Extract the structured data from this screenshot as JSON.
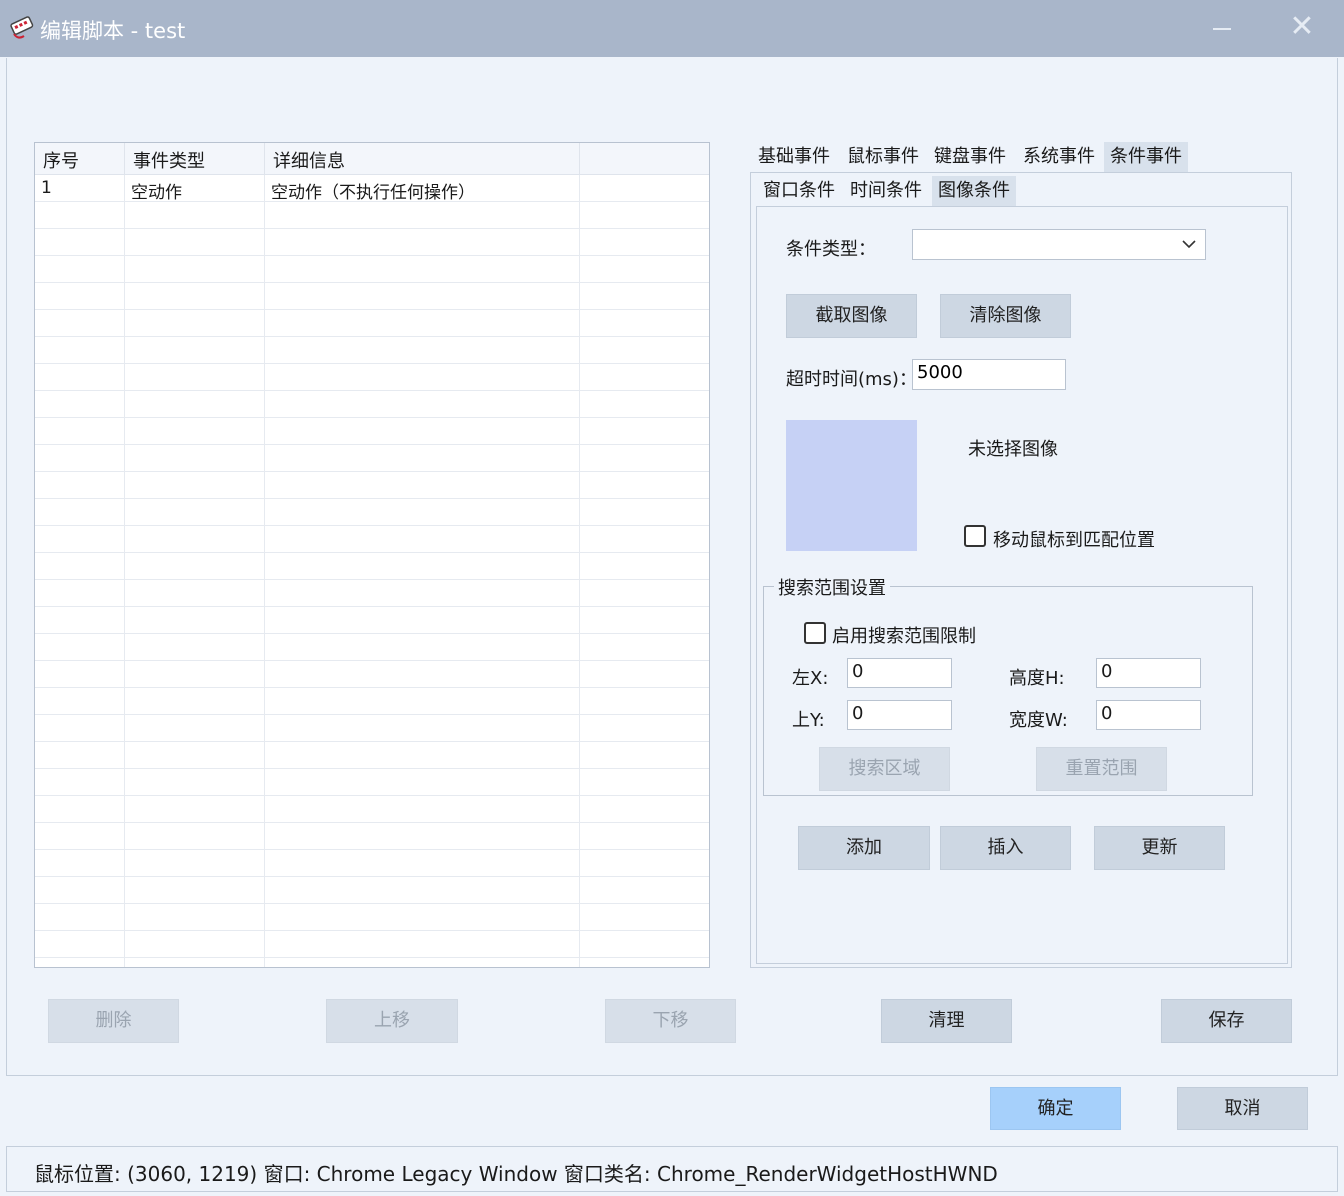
{
  "window": {
    "title": "编辑脚本 - test",
    "icon": "script-app-icon",
    "close_glyph": "✕"
  },
  "table": {
    "columns": [
      "序号",
      "事件类型",
      "详细信息",
      ""
    ],
    "rows": [
      [
        "1",
        "空动作",
        "空动作（不执行任何操作）",
        ""
      ]
    ]
  },
  "tabs": [
    "基础事件",
    "鼠标事件",
    "键盘事件",
    "系统事件",
    "条件事件"
  ],
  "subtabs": [
    "窗口条件",
    "时间条件",
    "图像条件"
  ],
  "form": {
    "condition_type_label": "条件类型：",
    "condition_type_value": "",
    "capture_button": "截取图像",
    "clear_button": "清除图像",
    "timeout_label": "超时时间(ms)：",
    "timeout_value": "5000",
    "no_image_text": "未选择图像",
    "move_mouse_label": "移动鼠标到匹配位置",
    "search_group_title": "搜索范围设置",
    "enable_search_label": "启用搜索范围限制",
    "left_x_label": "左X:",
    "left_x_value": "0",
    "top_y_label": "上Y:",
    "top_y_value": "0",
    "height_label": "高度H:",
    "height_value": "0",
    "width_label": "宽度W:",
    "width_value": "0",
    "search_area_button": "搜索区域",
    "reset_range_button": "重置范围",
    "add_button": "添加",
    "insert_button": "插入",
    "update_button": "更新"
  },
  "actions": {
    "delete": "删除",
    "move_up": "上移",
    "move_down": "下移",
    "clear": "清理",
    "save": "保存"
  },
  "dialog": {
    "ok": "确定",
    "cancel": "取消"
  },
  "status": "鼠标位置: (3060, 1219)  窗口: Chrome Legacy Window  窗口类名: Chrome_RenderWidgetHostHWND"
}
